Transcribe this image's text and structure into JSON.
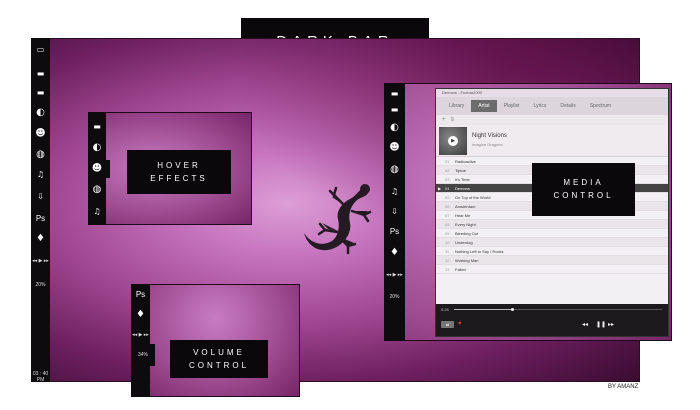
{
  "title_banner": "DARK-BAR",
  "hover_label": [
    "HOVER",
    "EFFECTS"
  ],
  "media_label": [
    "MEDIA",
    "CONTROL"
  ],
  "volume_label": [
    "VOLUME",
    "CONTROL"
  ],
  "credit": "BY AMANZ",
  "dock": {
    "ps_label": "Ps",
    "transport": "◂◂ ▶ ▸▸",
    "volume_main": "20%",
    "volume_media": "20%",
    "volume_card": "34%",
    "clock": "03 : 40 PM"
  },
  "player": {
    "window_title": "Demons - Foobar2000",
    "tabs": [
      "Library",
      "Artist",
      "Playlist",
      "Lyrics",
      "Details",
      "Spectrum"
    ],
    "active_tab": "Artist",
    "sub_buttons": [
      "+",
      "≡"
    ],
    "album_title": "Night Visions",
    "album_artist": "Imagine Dragons",
    "tracks": [
      {
        "num": "01",
        "name": "Radioactive"
      },
      {
        "num": "02",
        "name": "Tiptoe"
      },
      {
        "num": "03",
        "name": "It's Time"
      },
      {
        "num": "04",
        "name": "Demons"
      },
      {
        "num": "05",
        "name": "On Top of the World"
      },
      {
        "num": "06",
        "name": "Amsterdam"
      },
      {
        "num": "07",
        "name": "Hear Me"
      },
      {
        "num": "08",
        "name": "Every Night"
      },
      {
        "num": "09",
        "name": "Bleeding Out"
      },
      {
        "num": "10",
        "name": "Underdog"
      },
      {
        "num": "11",
        "name": "Nothing Left to Say / Rocks"
      },
      {
        "num": "12",
        "name": "Working Man"
      },
      {
        "num": "13",
        "name": "Fallen"
      }
    ],
    "active_track_index": 3,
    "elapsed": "0:24",
    "progress_fraction": 0.28,
    "colors": {
      "heart": "#d43b3b"
    }
  },
  "colors": {
    "bar": "#0e0b0e",
    "accent": "#b05ca6"
  }
}
